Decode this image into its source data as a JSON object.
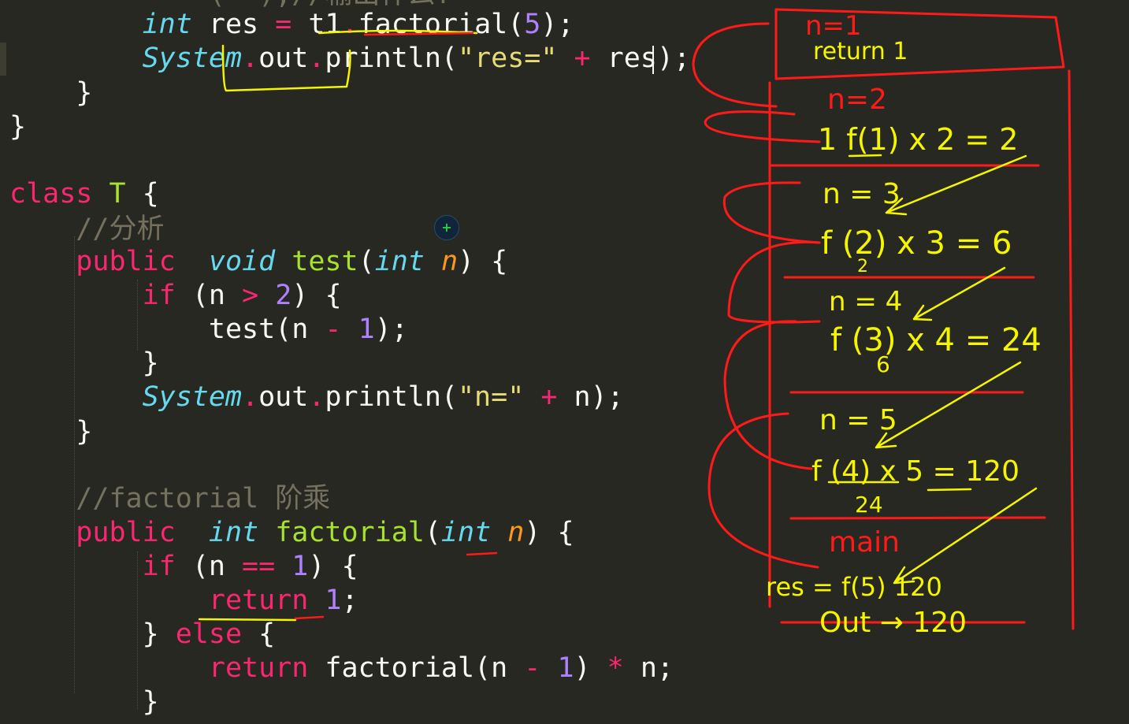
{
  "code": {
    "partial_top_text": "(  );//输出什么?",
    "comment_analysis": "//分析",
    "comment_factorial": "//factorial 阶乘",
    "tokens": {
      "int": "int",
      "res": "res",
      "eq": "=",
      "t1": "t1",
      "dot": ".",
      "factorial": "factorial",
      "lparen": "(",
      "rparen": ")",
      "five": "5",
      "semi": ";",
      "system": "System",
      "out": "out",
      "println": "println",
      "str_res": "\"res=\"",
      "plus": "+",
      "rbrace": "}",
      "lbrace": "{",
      "class": "class",
      "T": "T",
      "public": "public",
      "void": "void",
      "test": "test",
      "n": "n",
      "if": "if",
      "gt": ">",
      "two": "2",
      "minus": "-",
      "one": "1",
      "str_n": "\"n=\"",
      "eqeq": "==",
      "return": "return",
      "else": "else",
      "star": "*"
    }
  },
  "annotations": {
    "frame1_n": "n=1",
    "frame1_ret": "return 1",
    "frame2_n": "n=2",
    "frame2_expr": "1 f(1) x 2 = 2",
    "frame3_n": "n = 3",
    "frame3_expr": "f (2) x 3 = 6",
    "frame3_sub": "2",
    "frame4_n": "n = 4",
    "frame4_expr": "f (3) x 4 = 24",
    "frame4_sub": "6",
    "frame5_n": "n = 5",
    "frame5_expr": "f (4)  x  5  = 120",
    "frame5_sub": "24",
    "main_label": "main",
    "main_res": "res = f(5)  120",
    "main_out": "Out → 120"
  },
  "colors": {
    "background": "#272822",
    "annotation_red": "#ff1a1a",
    "annotation_yellow": "#f5f500"
  }
}
